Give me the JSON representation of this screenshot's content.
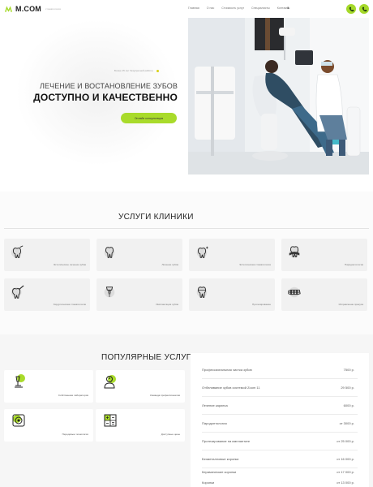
{
  "header": {
    "logo_text": "M.COM",
    "logo_sub": "стоматология",
    "nav": [
      "Главная",
      "О нас",
      "Стоимость услуг",
      "Специалисты",
      "Контакты"
    ],
    "phone": "8",
    "accent": "#a5d92a"
  },
  "hero": {
    "note": "Более 15 лет безупречной работы",
    "title_line1": "ЛЕЧЕНИЕ И ВОСТАНОВЛЕНИЕ ЗУБОВ",
    "title_line2": "ДОСТУПНО И КАЧЕСТВЕННО",
    "cta": "Онлайн консультация"
  },
  "services": {
    "title": "УСЛУГИ КЛИНИКИ",
    "items": [
      {
        "label": "Эстетическое лечение зубов",
        "icon": "tooth-drill-icon"
      },
      {
        "label": "Лечение зубов",
        "icon": "tooth-icon"
      },
      {
        "label": "Эстетическая стоматология",
        "icon": "tooth-sparkle-icon"
      },
      {
        "label": "Пародонтология",
        "icon": "gum-tooth-icon"
      },
      {
        "label": "Хирургическая стоматология",
        "icon": "tooth-surgery-icon"
      },
      {
        "label": "Имплантация зубов",
        "icon": "implant-icon"
      },
      {
        "label": "Протезирование",
        "icon": "crown-tooth-icon"
      },
      {
        "label": "Исправление прикуса",
        "icon": "braces-icon"
      }
    ]
  },
  "popular": {
    "title": "ПОПУЛЯРНЫЕ УСЛУГИ",
    "features": [
      {
        "label": "Собственная лаборатория",
        "icon": "microscope-icon"
      },
      {
        "label": "Команда профессионалов",
        "icon": "doctor-icon"
      },
      {
        "label": "Передовые технологии",
        "icon": "camera-lens-icon"
      },
      {
        "label": "Доступные цены",
        "icon": "calculator-icon"
      }
    ],
    "prices": [
      {
        "name": "Профессиональная чистка зубов",
        "price": "7500 р."
      },
      {
        "name": "Отбеливание зубов системой Zoom 11",
        "price": "29 500 р."
      },
      {
        "name": "Лечение кариеса",
        "price": "6000 р."
      },
      {
        "name": "Пародонтология",
        "price": "от 3000 р."
      },
      {
        "name": "Протезирование на имплантате",
        "price": "от 25 000 р."
      },
      {
        "name": "Безметалловые коронки",
        "price": "от 16 000 р."
      },
      {
        "name": "Керамические коронки",
        "price": "от 17 000 р."
      },
      {
        "name": "Коронки",
        "price": "от 13 000 р."
      }
    ]
  }
}
